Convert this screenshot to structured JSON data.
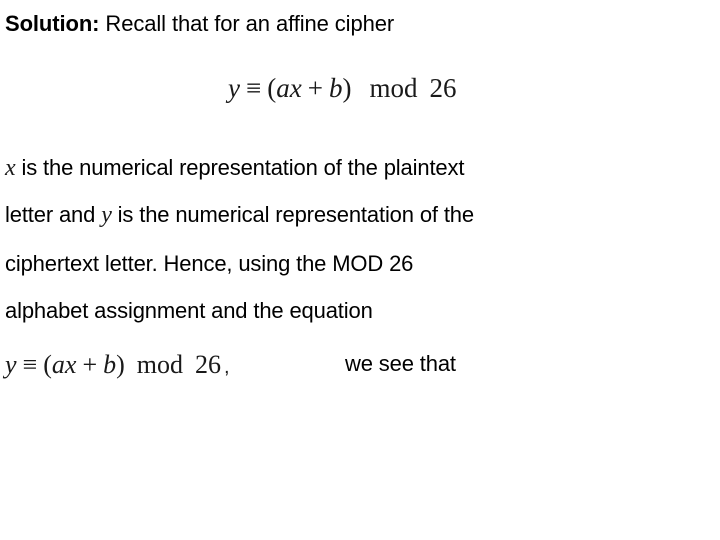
{
  "slide": {
    "background_color": "#ffffff",
    "text_color": "#000000",
    "title": {
      "label_bold": "Solution:",
      "label_rest": " Recall that for an affine cipher"
    },
    "display_equation": {
      "lhs_var": "y",
      "equiv_symbol": "≡",
      "open_paren": "(",
      "coefficient_var": "a",
      "plaintext_var": "x",
      "plus_symbol": "+",
      "shift_var": "b",
      "close_paren": ")",
      "mod_keyword": "mod",
      "modulus": "26",
      "full_text": "y ≡ (ax + b)  mod  26"
    },
    "body": {
      "line1_var": "x",
      "line1_text": " is the numerical representation of the plaintext",
      "line2_prefix": "letter and ",
      "line2_var": "y",
      "line2_text": " is the numerical representation of the",
      "line3_text": "ciphertext letter. Hence, using the MOD 26",
      "line4_text": "alphabet assignment  and the equation"
    },
    "last_line": {
      "equation": {
        "lhs_var": "y",
        "equiv_symbol": "≡",
        "open_paren": "(",
        "coefficient_var": "a",
        "plaintext_var": "x",
        "plus_symbol": "+",
        "shift_var": "b",
        "close_paren": ")",
        "mod_keyword": "mod",
        "modulus": "26",
        "trailing_comma": ",",
        "full_text": "y ≡ (ax + b)  mod  26 ,"
      },
      "tail_text": "we see that"
    }
  }
}
